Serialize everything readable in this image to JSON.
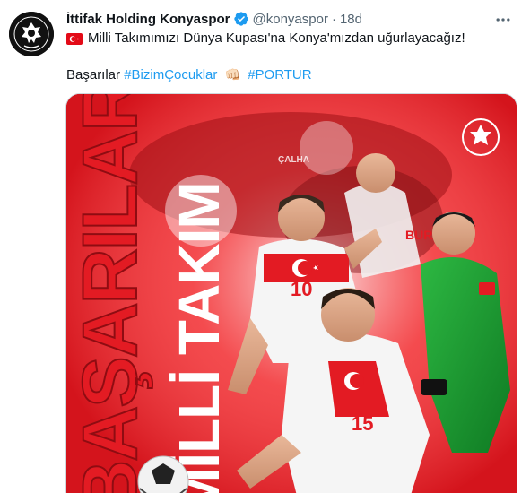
{
  "tweet": {
    "display_name": "İttifak Holding Konyaspor",
    "handle": "@konyaspor",
    "separator": "·",
    "time": "18d",
    "text_line1": "Milli Takımımızı Dünya Kupası'na Konya'mızdan uğurlayacağız!",
    "text_line2_prefix": "Başarılar",
    "hashtag1": "#BizimÇocuklar",
    "hashtag2": "#PORTUR"
  },
  "media": {
    "vertical_text_left": "BAŞARILAR",
    "vertical_text_right": "MİLLİ TAKIM",
    "jersey_number_1": "10",
    "jersey_number_2": "15",
    "player_name_back": "BURA",
    "player_name_back2": "ÇALHA"
  },
  "colors": {
    "accent_blue": "#1d9bf0",
    "turkish_red": "#e31b23",
    "secondary_text": "#536471"
  },
  "icons": [
    "verified-badge-icon",
    "more-options-icon",
    "turkish-flag-icon",
    "fist-emoji-icon"
  ]
}
